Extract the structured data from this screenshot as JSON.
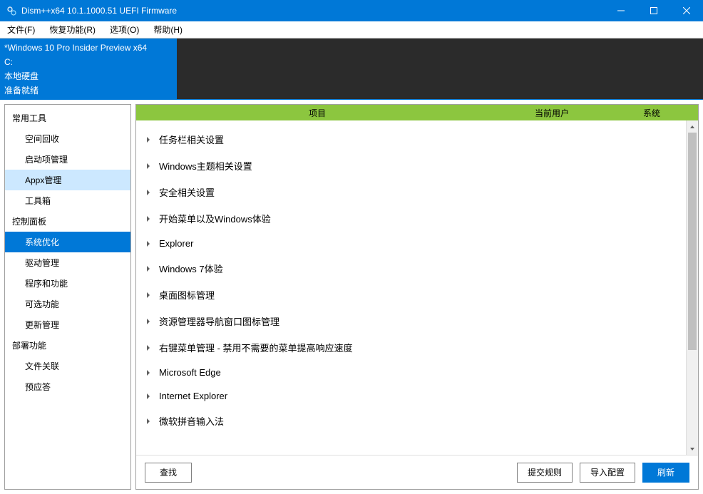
{
  "window": {
    "title": "Dism++x64 10.1.1000.51 UEFI Firmware"
  },
  "menubar": {
    "items": [
      "文件(F)",
      "恢复功能(R)",
      "选项(O)",
      "帮助(H)"
    ]
  },
  "info": {
    "os": "*Windows 10 Pro Insider Preview x64",
    "drive": "C:",
    "disk": "本地硬盘",
    "status": "准备就绪"
  },
  "sidebar": {
    "sections": [
      {
        "header": "常用工具",
        "items": [
          {
            "label": "空间回收",
            "state": ""
          },
          {
            "label": "启动项管理",
            "state": ""
          },
          {
            "label": "Appx管理",
            "state": "active-light"
          },
          {
            "label": "工具箱",
            "state": ""
          }
        ]
      },
      {
        "header": "控制面板",
        "items": [
          {
            "label": "系统优化",
            "state": "active-blue"
          },
          {
            "label": "驱动管理",
            "state": ""
          },
          {
            "label": "程序和功能",
            "state": ""
          },
          {
            "label": "可选功能",
            "state": ""
          },
          {
            "label": "更新管理",
            "state": ""
          }
        ]
      },
      {
        "header": "部署功能",
        "items": [
          {
            "label": "文件关联",
            "state": ""
          },
          {
            "label": "预应答",
            "state": ""
          }
        ]
      }
    ]
  },
  "columns": {
    "col1": "项目",
    "col2": "当前用户",
    "col3": "系统"
  },
  "tree": {
    "items": [
      "任务栏相关设置",
      "Windows主题相关设置",
      "安全相关设置",
      "开始菜单以及Windows体验",
      "Explorer",
      "Windows 7体验",
      "桌面图标管理",
      "资源管理器导航窗口图标管理",
      "右键菜单管理 - 禁用不需要的菜单提高响应速度",
      "Microsoft Edge",
      "Internet Explorer",
      "微软拼音输入法"
    ]
  },
  "buttons": {
    "find": "查找",
    "submitRule": "提交规则",
    "importConfig": "导入配置",
    "refresh": "刷新"
  }
}
